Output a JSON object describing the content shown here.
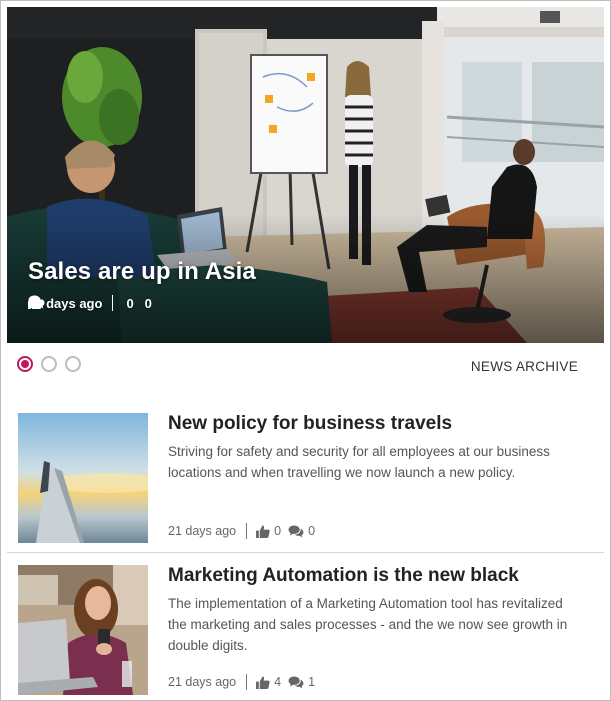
{
  "carousel": {
    "featured": {
      "title": "Sales are up in Asia",
      "age": "16 days ago",
      "likes": "0",
      "comments": "0"
    },
    "slides_count": 3,
    "active_slide": 1
  },
  "archive_link": "NEWS ARCHIVE",
  "accent_color": "#c2185b",
  "news": [
    {
      "title": "New policy for business travels",
      "text": "Striving for safety and security for all employees at our business locations and when travelling we now launch a new policy.",
      "age": "21 days ago",
      "likes": "0",
      "comments": "0"
    },
    {
      "title": "Marketing Automation is the new black",
      "text": "The implementation of a Marketing Automation tool has revitalized the marketing and sales processes - and the we now see growth in double digits.",
      "age": "21 days ago",
      "likes": "4",
      "comments": "1"
    }
  ],
  "icons": {
    "like": "thumbs-up-icon",
    "comments": "comments-icon"
  }
}
